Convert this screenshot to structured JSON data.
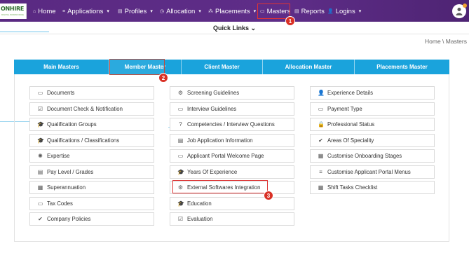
{
  "logo": {
    "text": "ONHIRE",
    "tag": "DIGITAL WORKFORCE"
  },
  "nav": [
    {
      "label": "Home",
      "icon": "⌂"
    },
    {
      "label": "Applications",
      "icon": "≡"
    },
    {
      "label": "Profiles",
      "icon": "▤"
    },
    {
      "label": "Allocation",
      "icon": "◷"
    },
    {
      "label": "Placements",
      "icon": "⁂"
    },
    {
      "label": "Masters",
      "icon": "▭"
    },
    {
      "label": "Reports",
      "icon": "▤"
    },
    {
      "label": "Logins",
      "icon": "👤"
    }
  ],
  "quick_links": "Quick Links",
  "breadcrumb": "Home \\ Masters",
  "tabs": [
    "Main Masters",
    "Member Master",
    "Client Master",
    "Allocation Master",
    "Placements Master"
  ],
  "badges": [
    "1",
    "2",
    "3"
  ],
  "col1": [
    {
      "label": "Documents",
      "icon": "▭"
    },
    {
      "label": "Document Check & Notification",
      "icon": "☑"
    },
    {
      "label": "Qualification Groups",
      "icon": "🎓"
    },
    {
      "label": "Qualifications / Classifications",
      "icon": "🎓"
    },
    {
      "label": "Expertise",
      "icon": "✺"
    },
    {
      "label": "Pay Level / Grades",
      "icon": "▤"
    },
    {
      "label": "Superannuation",
      "icon": "▦"
    },
    {
      "label": "Tax Codes",
      "icon": "▭"
    },
    {
      "label": "Company Policies",
      "icon": "✔"
    }
  ],
  "col2": [
    {
      "label": "Screening Guidelines",
      "icon": "⚙"
    },
    {
      "label": "Interview Guidelines",
      "icon": "▭"
    },
    {
      "label": "Competencies / Interview Questions",
      "icon": "?"
    },
    {
      "label": "Job Application Information",
      "icon": "▤"
    },
    {
      "label": "Applicant Portal Welcome Page",
      "icon": "▭"
    },
    {
      "label": "Years Of Experience",
      "icon": "🎓"
    },
    {
      "label": "External Softwares Integration",
      "icon": "⚙"
    },
    {
      "label": "Education",
      "icon": "🎓"
    },
    {
      "label": "Evaluation",
      "icon": "☑"
    }
  ],
  "col3": [
    {
      "label": "Experience Details",
      "icon": "👤"
    },
    {
      "label": "Payment Type",
      "icon": "▭"
    },
    {
      "label": "Professional Status",
      "icon": "🔒"
    },
    {
      "label": "Areas Of Speciality",
      "icon": "✔"
    },
    {
      "label": "Customise Onboarding Stages",
      "icon": "▦"
    },
    {
      "label": "Customise Applicant Portal Menus",
      "icon": "≡"
    },
    {
      "label": "Shift Tasks Checklist",
      "icon": "▦"
    }
  ]
}
